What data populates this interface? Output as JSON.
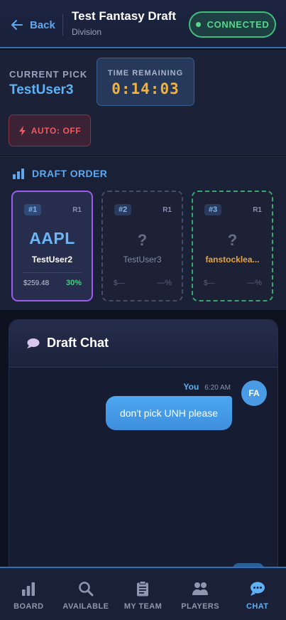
{
  "header": {
    "back_label": "Back",
    "title": "Test Fantasy Draft",
    "subtitle": "Division",
    "status": "CONNECTED"
  },
  "current_pick": {
    "label": "CURRENT PICK",
    "user": "TestUser3"
  },
  "timer": {
    "label": "TIME REMAINING",
    "value": "0:14:03"
  },
  "auto": {
    "label": "AUTO: OFF"
  },
  "draft_order": {
    "title": "DRAFT ORDER",
    "cards": [
      {
        "num": "#1",
        "round": "R1",
        "ticker": "AAPL",
        "user": "TestUser2",
        "price": "$259.48",
        "pct": "30%"
      },
      {
        "num": "#2",
        "round": "R1",
        "ticker": "?",
        "user": "TestUser3",
        "price": "$—",
        "pct": "—%"
      },
      {
        "num": "#3",
        "round": "R1",
        "ticker": "?",
        "user": "fanstocklea...",
        "price": "$—",
        "pct": "—%"
      }
    ]
  },
  "chat": {
    "title": "Draft Chat",
    "messages": [
      {
        "sender": "You",
        "time": "6:20 AM",
        "avatar": "FA",
        "text": "don't pick UNH please"
      }
    ]
  },
  "nav": {
    "items": [
      {
        "label": "BOARD",
        "icon": "bar-chart-icon"
      },
      {
        "label": "AVAILABLE",
        "icon": "search-icon"
      },
      {
        "label": "MY TEAM",
        "icon": "clipboard-icon"
      },
      {
        "label": "PLAYERS",
        "icon": "users-icon"
      },
      {
        "label": "CHAT",
        "icon": "chat-icon"
      }
    ],
    "active": "CHAT"
  },
  "colors": {
    "accent": "#5fa8ee",
    "connected": "#57d68d",
    "timer": "#f2b23b",
    "auto_off": "#ef5a62",
    "pick_highlight": "#9d5cf0",
    "next_pick": "#3aa56d"
  }
}
